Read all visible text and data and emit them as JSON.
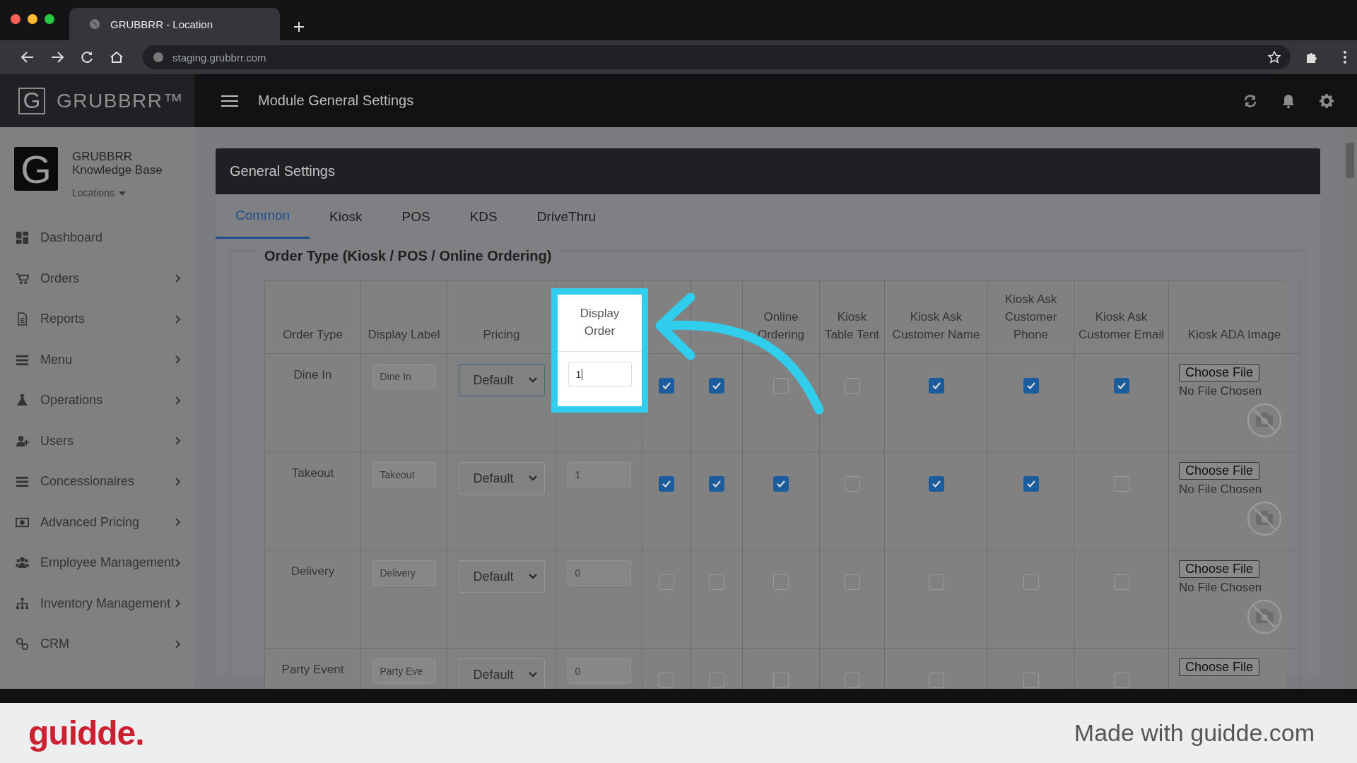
{
  "browser": {
    "tab_title": "GRUBBRR - Location",
    "url": "staging.grubbrr.com"
  },
  "app": {
    "logo_letter": "G",
    "brand": "GRUBBRR™",
    "title": "Module General Settings"
  },
  "sidebar": {
    "org_logo_letter": "G",
    "org_line1": "GRUBBRR",
    "org_line2": "Knowledge Base",
    "location_menu": "Locations",
    "items": [
      {
        "label": "Dashboard",
        "has_submenu": false
      },
      {
        "label": "Orders",
        "has_submenu": true
      },
      {
        "label": "Reports",
        "has_submenu": true
      },
      {
        "label": "Menu",
        "has_submenu": true
      },
      {
        "label": "Operations",
        "has_submenu": true
      },
      {
        "label": "Users",
        "has_submenu": true
      },
      {
        "label": "Concessionaires",
        "has_submenu": true
      },
      {
        "label": "Advanced Pricing",
        "has_submenu": true
      },
      {
        "label": "Employee Management",
        "has_submenu": true
      },
      {
        "label": "Inventory Management",
        "has_submenu": true
      },
      {
        "label": "CRM",
        "has_submenu": true
      }
    ]
  },
  "panel": {
    "title": "General Settings",
    "tabs": [
      {
        "label": "Common",
        "selected": true
      },
      {
        "label": "Kiosk",
        "selected": false
      },
      {
        "label": "POS",
        "selected": false
      },
      {
        "label": "KDS",
        "selected": false
      },
      {
        "label": "DriveThru",
        "selected": false
      }
    ],
    "section_title": "Order Type (Kiosk / POS / Online Ordering)"
  },
  "table": {
    "columns": [
      {
        "label": "Order Type",
        "highlighted": false
      },
      {
        "label": "Display Label",
        "highlighted": false
      },
      {
        "label": "Pricing",
        "highlighted": false
      },
      {
        "label": "Display Order",
        "highlighted": true
      },
      {
        "highlighted": false
      },
      {
        "highlighted": false
      },
      {
        "label": "Online Ordering",
        "highlighted": false
      },
      {
        "label": "Kiosk Table Tent",
        "highlighted": false
      },
      {
        "label": "Kiosk Ask Customer Name",
        "highlighted": false
      },
      {
        "label": "Kiosk Ask Customer Phone",
        "highlighted": false
      },
      {
        "label": "Kiosk Ask Customer Email",
        "highlighted": false
      },
      {
        "label": "Kiosk ADA Image",
        "highlighted": false
      }
    ],
    "rows": [
      {
        "order_type": "Dine In",
        "display_label": "Dine In",
        "pricing": "Default",
        "display_order": "1",
        "checks": [
          true,
          true,
          false,
          false,
          true,
          true,
          true
        ],
        "file_button": "Choose File",
        "file_status": "No File Chosen"
      },
      {
        "order_type": "Takeout",
        "display_label": "Takeout",
        "pricing": "Default",
        "display_order": "1",
        "checks": [
          true,
          true,
          true,
          false,
          true,
          true,
          false
        ],
        "file_button": "Choose File",
        "file_status": "No File Chosen"
      },
      {
        "order_type": "Delivery",
        "display_label": "Delivery",
        "pricing": "Default",
        "display_order": "0",
        "checks": [
          false,
          false,
          false,
          false,
          false,
          false,
          false
        ],
        "file_button": "Choose File",
        "file_status": "No File Chosen"
      },
      {
        "order_type": "Party Event",
        "display_label": "Party Eve",
        "pricing": "Default",
        "display_order": "0",
        "checks": [
          false,
          false,
          false,
          false,
          false,
          false,
          false
        ],
        "file_button": "Choose File"
      }
    ]
  },
  "footer": {
    "logo": "guidde.",
    "credit": "Made with guidde.com"
  }
}
